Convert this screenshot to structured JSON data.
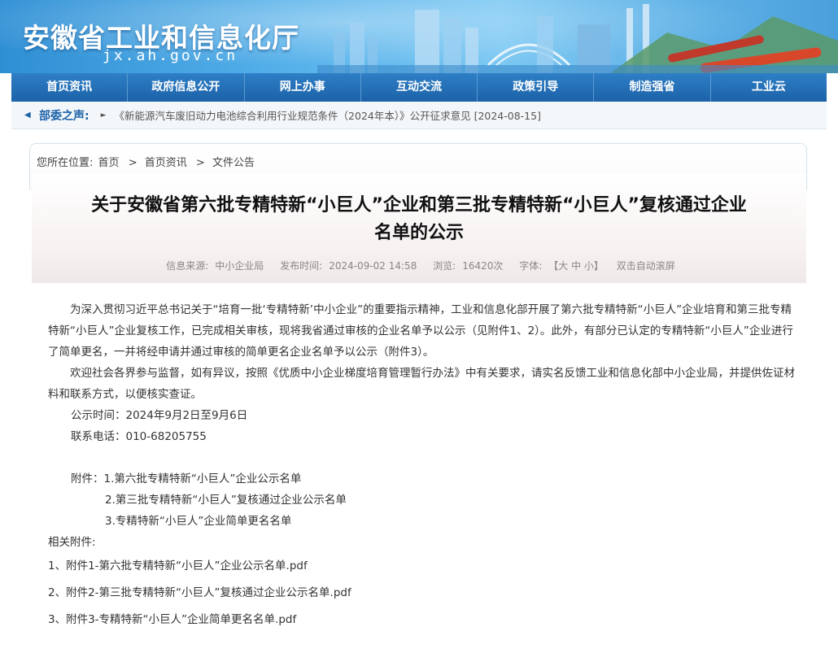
{
  "header": {
    "site_title": "安徽省工业和信息化厅",
    "site_domain": "jx.ah.gov.cn"
  },
  "nav": {
    "items": [
      "首页资讯",
      "政府信息公开",
      "网上办事",
      "互动交流",
      "政策引导",
      "制造强省",
      "工业云"
    ]
  },
  "ticker": {
    "label": "部委之声:",
    "news": "《新能源汽车废旧动力电池综合利用行业规范条件（2024年本）》公开征求意见 [2024-08-15]"
  },
  "breadcrumb": {
    "prefix": "您所在位置:",
    "items": [
      "首页",
      "首页资讯",
      "文件公告"
    ],
    "sep": ">"
  },
  "article": {
    "title_line1": "关于安徽省第六批专精特新“小巨人”企业和第三批专精特新“小巨人”复核通过企业",
    "title_line2": "名单的公示",
    "meta": {
      "source_label": "信息来源:",
      "source": "中小企业局",
      "time_label": "发布时间:",
      "time": "2024-09-02 14:58",
      "views_label": "浏览:",
      "views": "16420次",
      "font_label": "字体:",
      "font_sizes": "【大 中 小】",
      "autoscroll": "双击自动滚屏"
    },
    "paragraph1": "为深入贯彻习近平总书记关于“培育一批‘专精特新’中小企业”的重要指示精神，工业和信息化部开展了第六批专精特新“小巨人”企业培育和第三批专精特新“小巨人”企业复核工作，已完成相关审核，现将我省通过审核的企业名单予以公示（见附件1、2）。此外，有部分已认定的专精特新“小巨人”企业进行了简单更名，一并将经申请并通过审核的简单更名企业名单予以公示（附件3）。",
    "paragraph2": "欢迎社会各界参与监督，如有异议，按照《优质中小企业梯度培育管理暂行办法》中有关要求，请实名反馈工业和信息化部中小企业局，并提供佐证材料和联系方式，以便核实查证。",
    "notice_time": "公示时间：2024年9月2日至9月6日",
    "contact": "联系电话：010-68205755",
    "attach_label": "附件：",
    "attachments": [
      "1.第六批专精特新“小巨人”企业公示名单",
      "2.第三批专精特新“小巨人”复核通过企业公示名单",
      "3.专精特新“小巨人”企业简单更名名单"
    ],
    "related_label": "相关附件:",
    "files": [
      "1、附件1-第六批专精特新“小巨人”企业公示名单.pdf",
      "2、附件2-第三批专精特新“小巨人”复核通过企业公示名单.pdf",
      "3、附件3-专精特新“小巨人”企业简单更名名单.pdf"
    ]
  }
}
